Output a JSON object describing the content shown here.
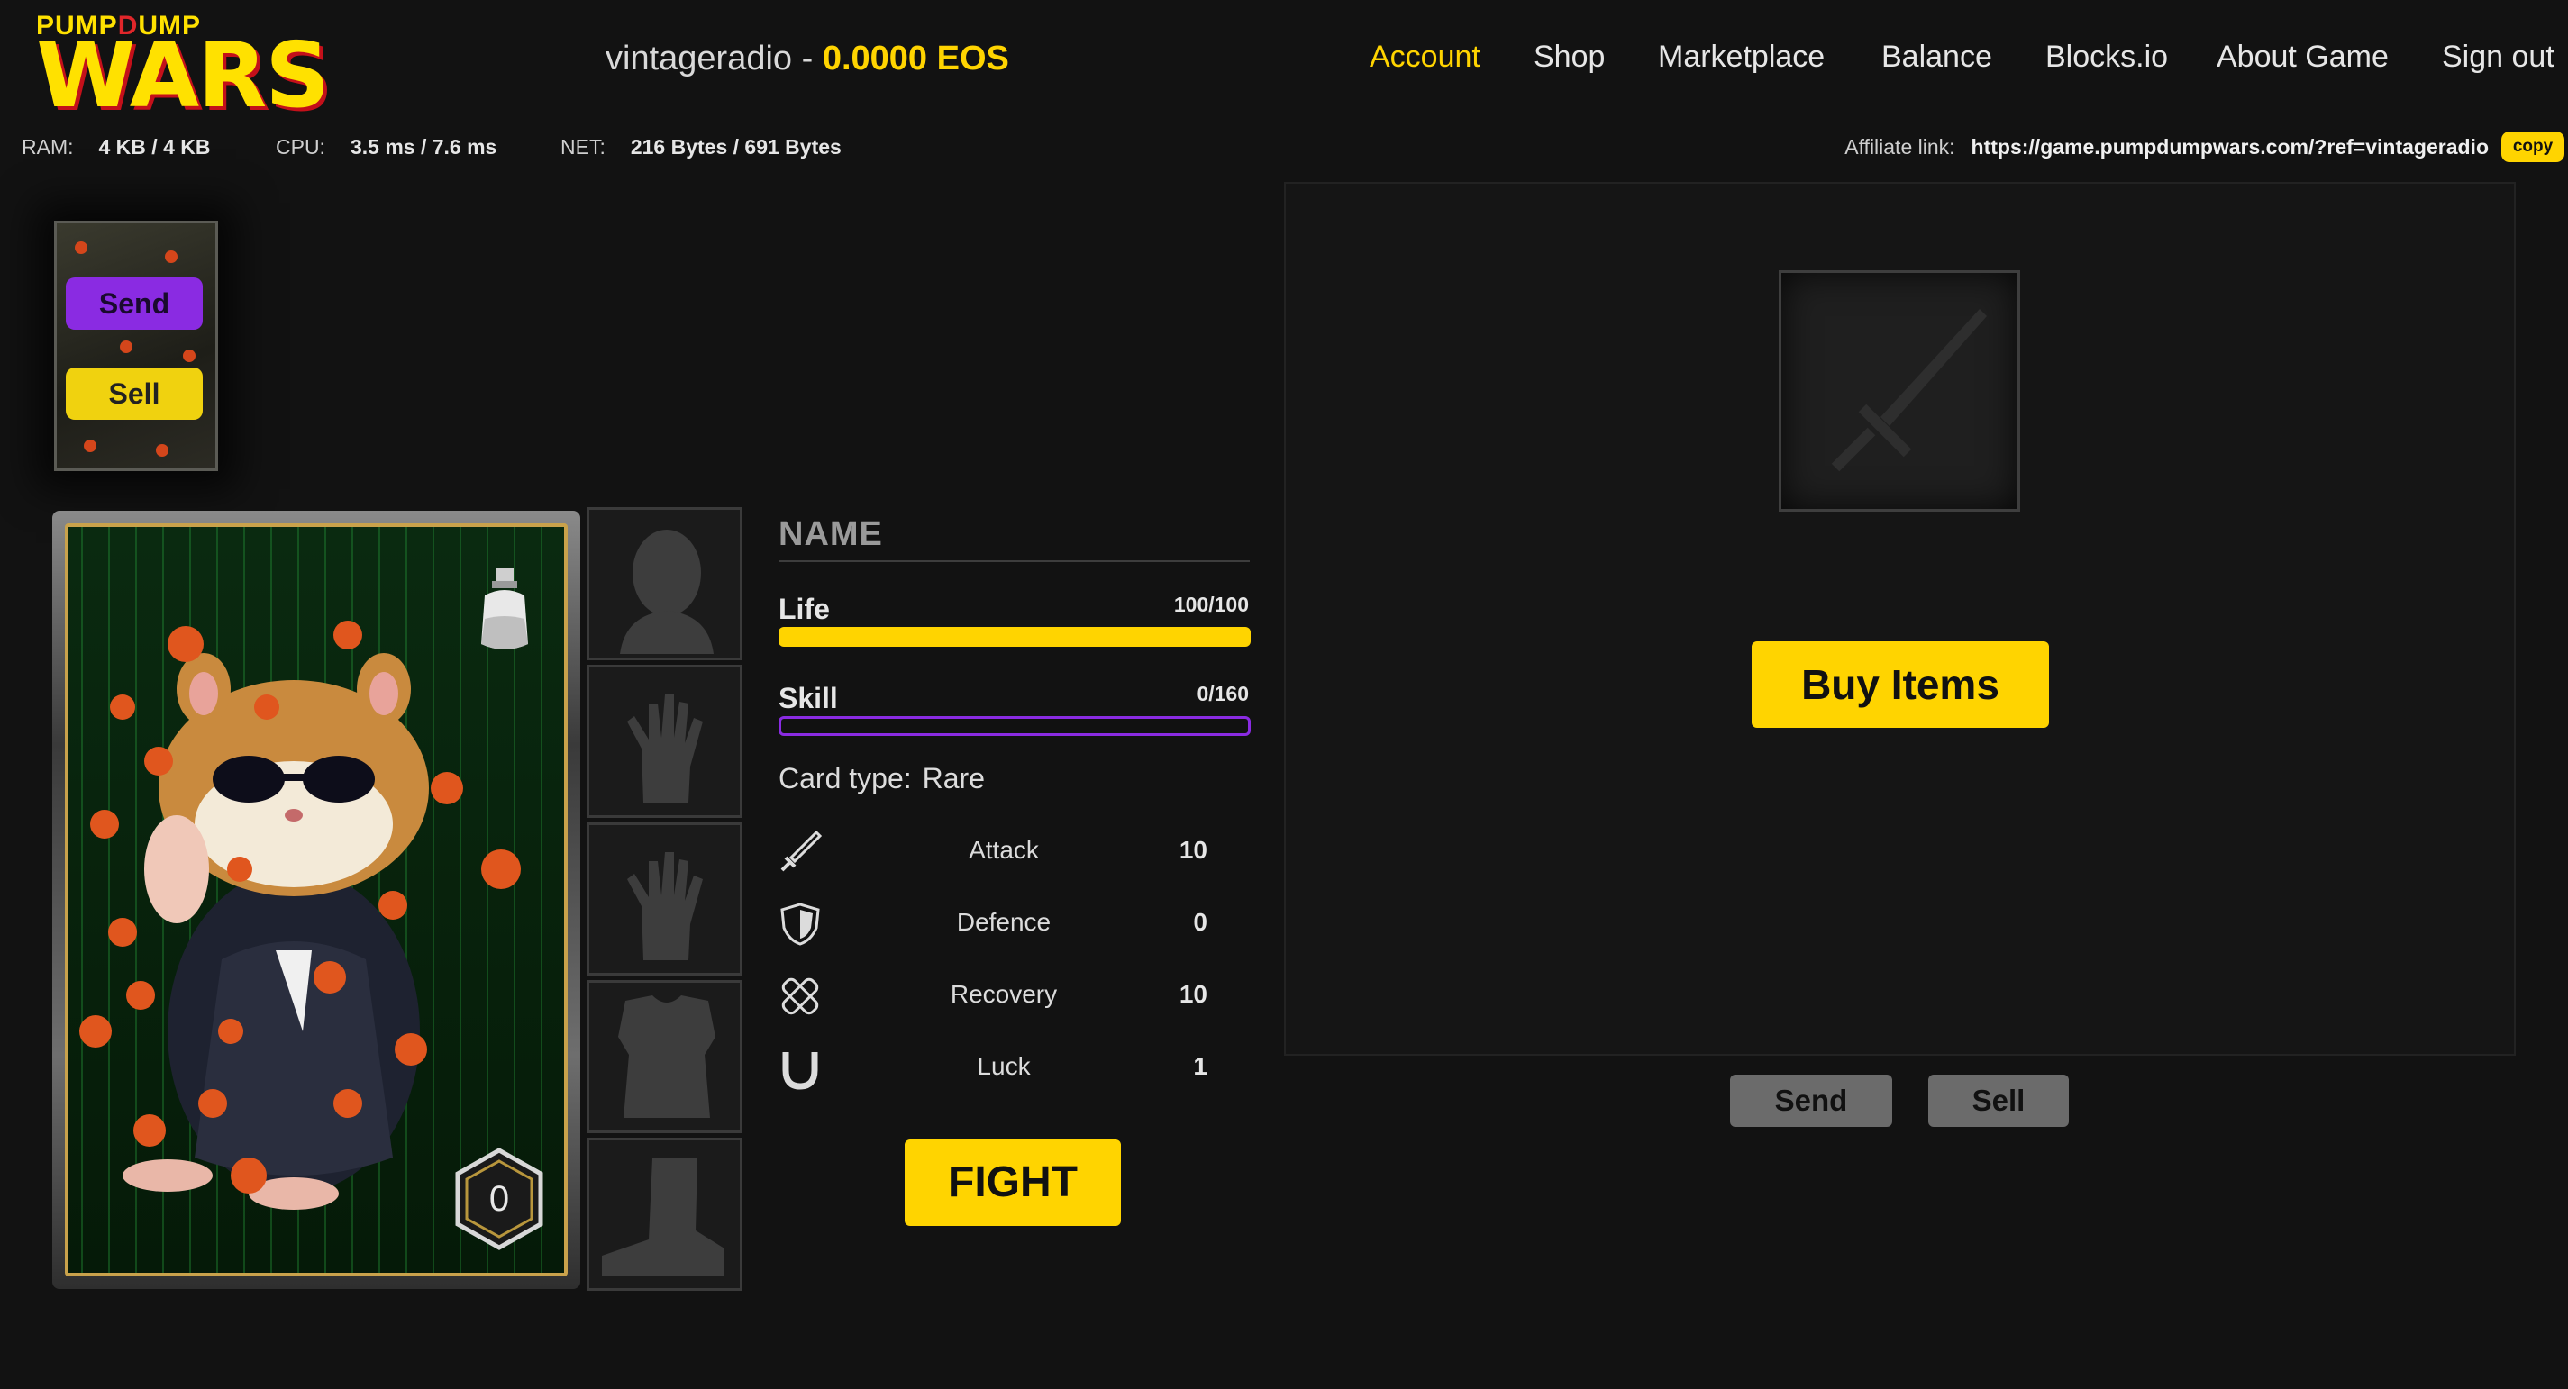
{
  "logo": {
    "line1_a": "PUMP",
    "line1_b": "D",
    "line1_c": "UMP",
    "main": "WARS"
  },
  "header": {
    "username": "vintageradio",
    "separator": " - ",
    "balance": "0.0000 EOS",
    "nav": [
      "Account",
      "Shop",
      "Marketplace",
      "Balance",
      "Blocks.io",
      "About Game",
      "Sign out"
    ],
    "active_nav": "Account"
  },
  "resources": {
    "ram_label": "RAM:",
    "ram_value": "4 KB / 4 KB",
    "cpu_label": "CPU:",
    "cpu_value": "3.5 ms / 7.6 ms",
    "net_label": "NET:",
    "net_value": "216 Bytes / 691 Bytes"
  },
  "affiliate": {
    "label": "Affiliate link:",
    "url": "https://game.pumpdumpwars.com/?ref=vintageradio",
    "copy_label": "copy"
  },
  "mini_card": {
    "send_label": "Send",
    "sell_label": "Sell"
  },
  "card": {
    "level": "0"
  },
  "slots": [
    "head-slot",
    "left-hand-slot",
    "right-hand-slot",
    "body-slot",
    "boots-slot"
  ],
  "stats_panel": {
    "name": "NAME",
    "life_label": "Life",
    "life_value": "100/100",
    "life_fraction": 1.0,
    "skill_label": "Skill",
    "skill_value": "0/160",
    "skill_fraction": 0.0,
    "card_type_label": "Card type:",
    "card_type_value": "Rare",
    "stats": [
      {
        "icon": "sword-icon",
        "name": "Attack",
        "value": "10"
      },
      {
        "icon": "shield-icon",
        "name": "Defence",
        "value": "0"
      },
      {
        "icon": "bandage-icon",
        "name": "Recovery",
        "value": "10"
      },
      {
        "icon": "horseshoe-icon",
        "name": "Luck",
        "value": "1"
      }
    ],
    "fight_label": "FIGHT"
  },
  "items_panel": {
    "buy_label": "Buy Items",
    "send_label": "Send",
    "sell_label": "Sell"
  },
  "colors": {
    "accent": "#ffd400",
    "purple": "#8a2be2",
    "bg": "#121212"
  }
}
